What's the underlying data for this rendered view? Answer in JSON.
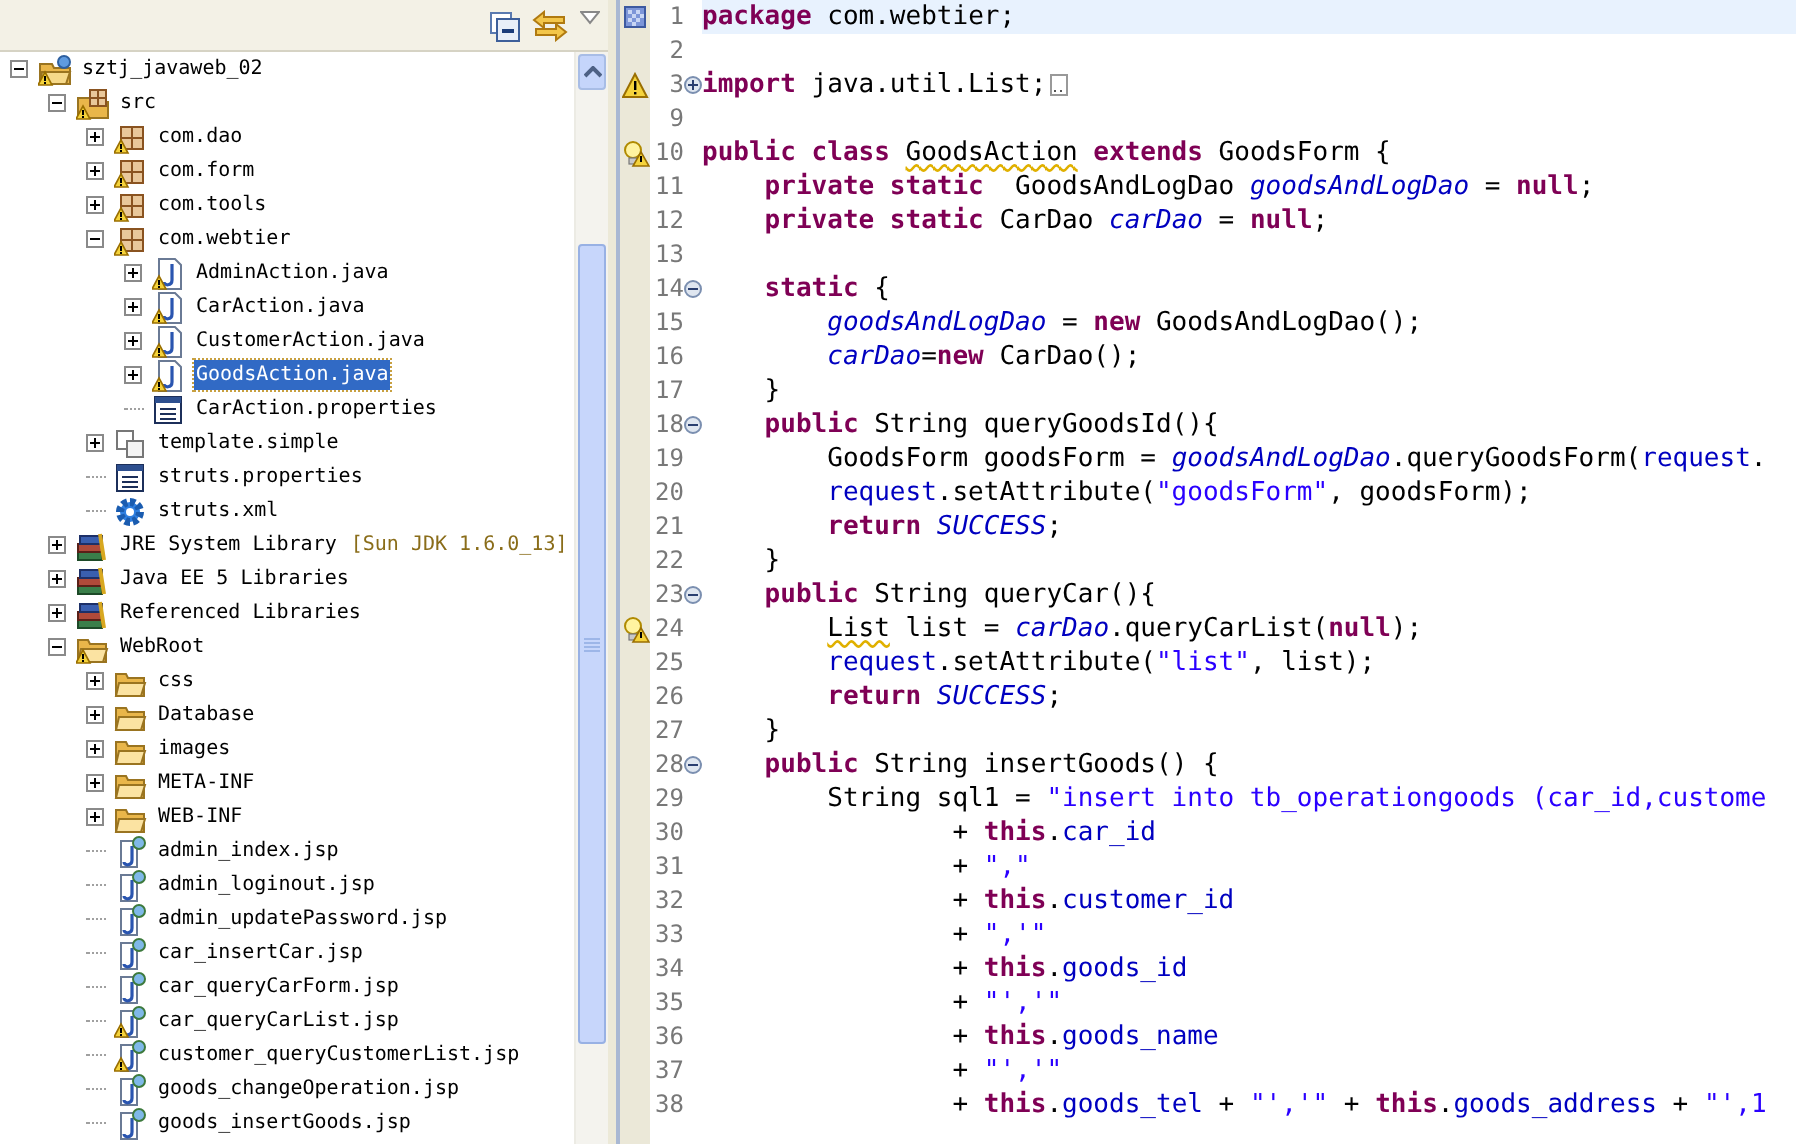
{
  "tree": {
    "items": [
      {
        "label": "sztj_javaweb_02",
        "kind": "project",
        "expanded": true,
        "warning": true,
        "selected": false,
        "children": [
          {
            "label": "src",
            "kind": "source-folder",
            "expanded": true,
            "warning": true,
            "selected": false,
            "children": [
              {
                "label": "com.dao",
                "kind": "package",
                "expanded": false,
                "warning": true,
                "selected": false
              },
              {
                "label": "com.form",
                "kind": "package",
                "expanded": false,
                "warning": true,
                "selected": false
              },
              {
                "label": "com.tools",
                "kind": "package",
                "expanded": false,
                "warning": true,
                "selected": false
              },
              {
                "label": "com.webtier",
                "kind": "package",
                "expanded": true,
                "warning": true,
                "selected": false,
                "children": [
                  {
                    "label": "AdminAction.java",
                    "kind": "java",
                    "expanded": false,
                    "warning": true,
                    "selected": false
                  },
                  {
                    "label": "CarAction.java",
                    "kind": "java",
                    "expanded": false,
                    "warning": true,
                    "selected": false
                  },
                  {
                    "label": "CustomerAction.java",
                    "kind": "java",
                    "expanded": false,
                    "warning": true,
                    "selected": false
                  },
                  {
                    "label": "GoodsAction.java",
                    "kind": "java",
                    "expanded": false,
                    "warning": true,
                    "selected": true
                  },
                  {
                    "label": "CarAction.properties",
                    "kind": "properties",
                    "warning": false,
                    "selected": false
                  }
                ]
              },
              {
                "label": "template.simple",
                "kind": "template",
                "expanded": false,
                "warning": false,
                "selected": false
              },
              {
                "label": "struts.properties",
                "kind": "properties",
                "warning": false,
                "selected": false
              },
              {
                "label": "struts.xml",
                "kind": "xml",
                "warning": false,
                "selected": false
              }
            ]
          },
          {
            "label": "JRE System Library",
            "decoration": "[Sun JDK 1.6.0_13]",
            "kind": "library",
            "expanded": false,
            "warning": false,
            "selected": false
          },
          {
            "label": "Java EE 5 Libraries",
            "kind": "library",
            "expanded": false,
            "warning": false,
            "selected": false
          },
          {
            "label": "Referenced Libraries",
            "kind": "library",
            "expanded": false,
            "warning": false,
            "selected": false
          },
          {
            "label": "WebRoot",
            "kind": "folder",
            "expanded": true,
            "warning": true,
            "selected": false,
            "children": [
              {
                "label": "css",
                "kind": "folder",
                "expanded": false,
                "warning": false,
                "selected": false
              },
              {
                "label": "Database",
                "kind": "folder",
                "expanded": false,
                "warning": false,
                "selected": false
              },
              {
                "label": "images",
                "kind": "folder",
                "expanded": false,
                "warning": false,
                "selected": false
              },
              {
                "label": "META-INF",
                "kind": "folder",
                "expanded": false,
                "warning": false,
                "selected": false
              },
              {
                "label": "WEB-INF",
                "kind": "folder",
                "expanded": false,
                "warning": false,
                "selected": false
              },
              {
                "label": "admin_index.jsp",
                "kind": "jsp",
                "warning": false,
                "selected": false
              },
              {
                "label": "admin_loginout.jsp",
                "kind": "jsp",
                "warning": false,
                "selected": false
              },
              {
                "label": "admin_updatePassword.jsp",
                "kind": "jsp",
                "warning": false,
                "selected": false
              },
              {
                "label": "car_insertCar.jsp",
                "kind": "jsp",
                "warning": false,
                "selected": false
              },
              {
                "label": "car_queryCarForm.jsp",
                "kind": "jsp",
                "warning": false,
                "selected": false
              },
              {
                "label": "car_queryCarList.jsp",
                "kind": "jsp",
                "warning": true,
                "selected": false
              },
              {
                "label": "customer_queryCustomerList.jsp",
                "kind": "jsp",
                "warning": true,
                "selected": false
              },
              {
                "label": "goods_changeOperation.jsp",
                "kind": "jsp",
                "warning": false,
                "selected": false
              },
              {
                "label": "goods_insertGoods.jsp",
                "kind": "jsp",
                "warning": false,
                "selected": false
              }
            ]
          }
        ]
      }
    ]
  },
  "editor": {
    "lines": [
      {
        "number": "1",
        "current": true,
        "marker": {
          "kind": "bookmark"
        },
        "tokens": [
          {
            "kind": "keyword",
            "text": "package"
          },
          {
            "kind": "plain",
            "text": " com.webtier;"
          }
        ]
      },
      {
        "number": "2",
        "current": false
      },
      {
        "number": "3",
        "current": false,
        "marker": {
          "kind": "warning"
        },
        "fold": {
          "expanded": false
        },
        "tokens": [
          {
            "kind": "keyword",
            "text": "import"
          },
          {
            "kind": "plain",
            "text": " java.util.List;"
          }
        ]
      },
      {
        "number": "9",
        "current": false
      },
      {
        "number": "10",
        "current": false,
        "marker": {
          "kind": "quickfix"
        },
        "tokens": [
          {
            "kind": "keyword",
            "text": "public class "
          },
          {
            "kind": "warning",
            "text": "GoodsAction"
          },
          {
            "kind": "keyword",
            "text": " extends"
          },
          {
            "kind": "plain",
            "text": " GoodsForm {"
          }
        ]
      },
      {
        "number": "11",
        "current": false,
        "tokens": [
          {
            "kind": "keyword",
            "text": "    private static"
          },
          {
            "kind": "plain",
            "text": "  GoodsAndLogDao "
          },
          {
            "kind": "static",
            "text": "goodsAndLogDao"
          },
          {
            "kind": "plain",
            "text": " = "
          },
          {
            "kind": "keyword",
            "text": "null"
          },
          {
            "kind": "plain",
            "text": ";"
          }
        ]
      },
      {
        "number": "12",
        "current": false,
        "tokens": [
          {
            "kind": "keyword",
            "text": "    private static"
          },
          {
            "kind": "plain",
            "text": " CarDao "
          },
          {
            "kind": "static",
            "text": "carDao"
          },
          {
            "kind": "plain",
            "text": " = "
          },
          {
            "kind": "keyword",
            "text": "null"
          },
          {
            "kind": "plain",
            "text": ";"
          }
        ]
      },
      {
        "number": "13",
        "current": false
      },
      {
        "number": "14",
        "current": false,
        "fold": {
          "expanded": true
        },
        "tokens": [
          {
            "kind": "keyword",
            "text": "    static"
          },
          {
            "kind": "plain",
            "text": " {"
          }
        ]
      },
      {
        "number": "15",
        "current": false,
        "tokens": [
          {
            "kind": "static",
            "text": "        goodsAndLogDao"
          },
          {
            "kind": "plain",
            "text": " = "
          },
          {
            "kind": "keyword",
            "text": "new"
          },
          {
            "kind": "plain",
            "text": " GoodsAndLogDao();"
          }
        ]
      },
      {
        "number": "16",
        "current": false,
        "tokens": [
          {
            "kind": "static",
            "text": "        carDao"
          },
          {
            "kind": "plain",
            "text": "="
          },
          {
            "kind": "keyword",
            "text": "new"
          },
          {
            "kind": "plain",
            "text": " CarDao();"
          }
        ]
      },
      {
        "number": "17",
        "current": false,
        "tokens": [
          {
            "kind": "plain",
            "text": "    }"
          }
        ]
      },
      {
        "number": "18",
        "current": false,
        "fold": {
          "expanded": true
        },
        "tokens": [
          {
            "kind": "keyword",
            "text": "    public"
          },
          {
            "kind": "plain",
            "text": " String queryGoodsId(){"
          }
        ]
      },
      {
        "number": "19",
        "current": false,
        "tokens": [
          {
            "kind": "plain",
            "text": "        GoodsForm goodsForm = "
          },
          {
            "kind": "static",
            "text": "goodsAndLogDao"
          },
          {
            "kind": "plain",
            "text": ".queryGoodsForm("
          },
          {
            "kind": "field",
            "text": "request"
          },
          {
            "kind": "plain",
            "text": "."
          }
        ]
      },
      {
        "number": "20",
        "current": false,
        "tokens": [
          {
            "kind": "field",
            "text": "        request"
          },
          {
            "kind": "plain",
            "text": ".setAttribute("
          },
          {
            "kind": "string",
            "text": "\"goodsForm\""
          },
          {
            "kind": "plain",
            "text": ", goodsForm);"
          }
        ]
      },
      {
        "number": "21",
        "current": false,
        "tokens": [
          {
            "kind": "keyword",
            "text": "        return "
          },
          {
            "kind": "static",
            "text": "SUCCESS"
          },
          {
            "kind": "plain",
            "text": ";"
          }
        ]
      },
      {
        "number": "22",
        "current": false,
        "tokens": [
          {
            "kind": "plain",
            "text": "    }"
          }
        ]
      },
      {
        "number": "23",
        "current": false,
        "fold": {
          "expanded": true
        },
        "tokens": [
          {
            "kind": "keyword",
            "text": "    public"
          },
          {
            "kind": "plain",
            "text": " String queryCar(){"
          }
        ]
      },
      {
        "number": "24",
        "current": false,
        "marker": {
          "kind": "quickfix"
        },
        "tokens": [
          {
            "kind": "warning",
            "text": "        List"
          },
          {
            "kind": "plain",
            "text": " list = "
          },
          {
            "kind": "static",
            "text": "carDao"
          },
          {
            "kind": "plain",
            "text": ".queryCarList("
          },
          {
            "kind": "keyword",
            "text": "null"
          },
          {
            "kind": "plain",
            "text": ");"
          }
        ]
      },
      {
        "number": "25",
        "current": false,
        "tokens": [
          {
            "kind": "field",
            "text": "        request"
          },
          {
            "kind": "plain",
            "text": ".setAttribute("
          },
          {
            "kind": "string",
            "text": "\"list\""
          },
          {
            "kind": "plain",
            "text": ", list);"
          }
        ]
      },
      {
        "number": "26",
        "current": false,
        "tokens": [
          {
            "kind": "keyword",
            "text": "        return "
          },
          {
            "kind": "static",
            "text": "SUCCESS"
          },
          {
            "kind": "plain",
            "text": ";"
          }
        ]
      },
      {
        "number": "27",
        "current": false,
        "tokens": [
          {
            "kind": "plain",
            "text": "    }"
          }
        ]
      },
      {
        "number": "28",
        "current": false,
        "fold": {
          "expanded": true
        },
        "tokens": [
          {
            "kind": "keyword",
            "text": "    public"
          },
          {
            "kind": "plain",
            "text": " String insertGoods() {"
          }
        ]
      },
      {
        "number": "29",
        "current": false,
        "tokens": [
          {
            "kind": "plain",
            "text": "        String sql1 = "
          },
          {
            "kind": "string",
            "text": "\"insert into tb_operationgoods (car_id,custome"
          }
        ]
      },
      {
        "number": "30",
        "current": false,
        "tokens": [
          {
            "kind": "plain",
            "text": "                + "
          },
          {
            "kind": "keyword",
            "text": "this"
          },
          {
            "kind": "plain",
            "text": "."
          },
          {
            "kind": "field",
            "text": "car_id"
          }
        ]
      },
      {
        "number": "31",
        "current": false,
        "tokens": [
          {
            "kind": "plain",
            "text": "                + "
          },
          {
            "kind": "string",
            "text": "\",\""
          }
        ]
      },
      {
        "number": "32",
        "current": false,
        "tokens": [
          {
            "kind": "plain",
            "text": "                + "
          },
          {
            "kind": "keyword",
            "text": "this"
          },
          {
            "kind": "plain",
            "text": "."
          },
          {
            "kind": "field",
            "text": "customer_id"
          }
        ]
      },
      {
        "number": "33",
        "current": false,
        "tokens": [
          {
            "kind": "plain",
            "text": "                + "
          },
          {
            "kind": "string",
            "text": "\",'\""
          }
        ]
      },
      {
        "number": "34",
        "current": false,
        "tokens": [
          {
            "kind": "plain",
            "text": "                + "
          },
          {
            "kind": "keyword",
            "text": "this"
          },
          {
            "kind": "plain",
            "text": "."
          },
          {
            "kind": "field",
            "text": "goods_id"
          }
        ]
      },
      {
        "number": "35",
        "current": false,
        "tokens": [
          {
            "kind": "plain",
            "text": "                + "
          },
          {
            "kind": "string",
            "text": "\"','\""
          }
        ]
      },
      {
        "number": "36",
        "current": false,
        "tokens": [
          {
            "kind": "plain",
            "text": "                + "
          },
          {
            "kind": "keyword",
            "text": "this"
          },
          {
            "kind": "plain",
            "text": "."
          },
          {
            "kind": "field",
            "text": "goods_name"
          }
        ]
      },
      {
        "number": "37",
        "current": false,
        "tokens": [
          {
            "kind": "plain",
            "text": "                + "
          },
          {
            "kind": "string",
            "text": "\"','\""
          }
        ]
      },
      {
        "number": "38",
        "current": false,
        "tokens": [
          {
            "kind": "plain",
            "text": "                + "
          },
          {
            "kind": "keyword",
            "text": "this"
          },
          {
            "kind": "plain",
            "text": "."
          },
          {
            "kind": "field",
            "text": "goods_tel"
          },
          {
            "kind": "plain",
            "text": " + "
          },
          {
            "kind": "string",
            "text": "\"','\""
          },
          {
            "kind": "plain",
            "text": " + "
          },
          {
            "kind": "keyword",
            "text": "this"
          },
          {
            "kind": "plain",
            "text": "."
          },
          {
            "kind": "field",
            "text": "goods_address"
          },
          {
            "kind": "plain",
            "text": " + "
          },
          {
            "kind": "string",
            "text": "\"',1"
          }
        ]
      }
    ]
  }
}
